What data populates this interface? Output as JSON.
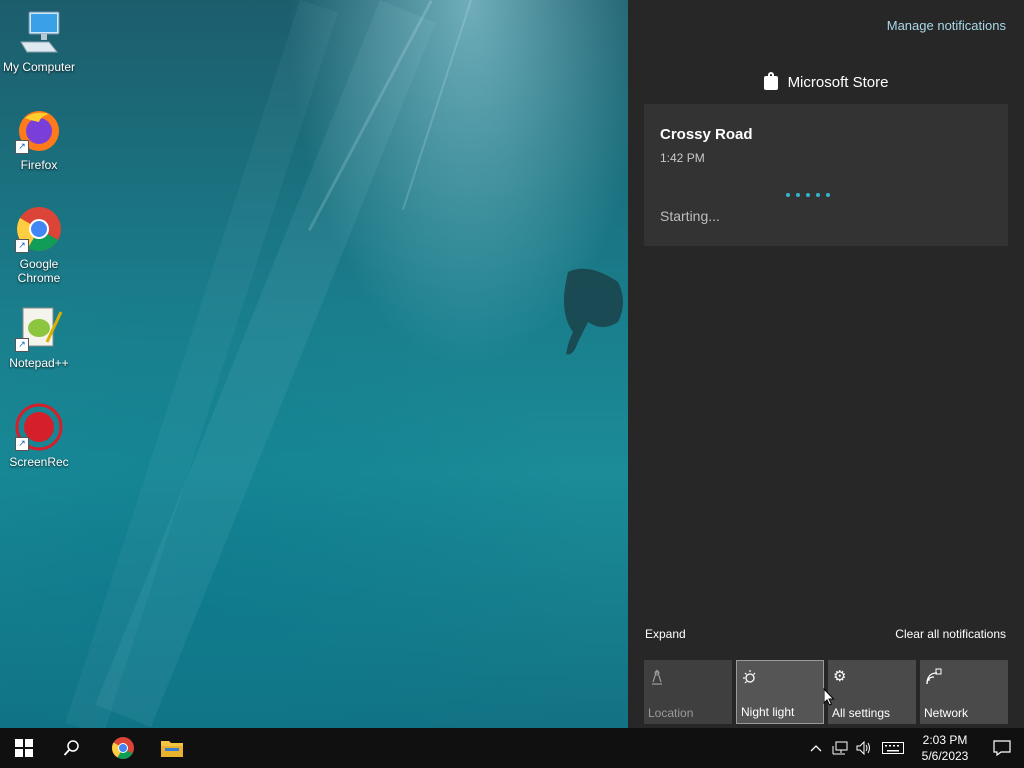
{
  "desktop": {
    "icons": [
      {
        "label": "My Computer",
        "icon": "computer-icon"
      },
      {
        "label": "Firefox",
        "icon": "firefox-icon"
      },
      {
        "label": "Google Chrome",
        "icon": "chrome-icon"
      },
      {
        "label": "Notepad++",
        "icon": "notepadpp-icon"
      },
      {
        "label": "ScreenRec",
        "icon": "screenrec-icon"
      }
    ]
  },
  "action_center": {
    "manage_label": "Manage notifications",
    "app_name": "Microsoft Store",
    "notification": {
      "title": "Crossy Road",
      "time": "1:42 PM",
      "status": "Starting..."
    },
    "expand_label": "Expand",
    "clear_label": "Clear all notifications",
    "quick_actions": [
      {
        "label": "Location",
        "icon": "location-icon",
        "state": "disabled"
      },
      {
        "label": "Night light",
        "icon": "night-light-icon",
        "state": "hover"
      },
      {
        "label": "All settings",
        "icon": "gear-icon",
        "state": "normal"
      },
      {
        "label": "Network",
        "icon": "network-icon",
        "state": "normal"
      }
    ]
  },
  "taskbar": {
    "pinned": [
      "start-icon",
      "search-icon",
      "chrome-icon",
      "file-explorer-icon"
    ],
    "clock_time": "2:03 PM",
    "clock_date": "5/6/2023"
  },
  "colors": {
    "panel_bg": "#272727",
    "toast_bg": "#333333",
    "accent": "#38b3c9",
    "taskbar_bg": "#101010"
  }
}
